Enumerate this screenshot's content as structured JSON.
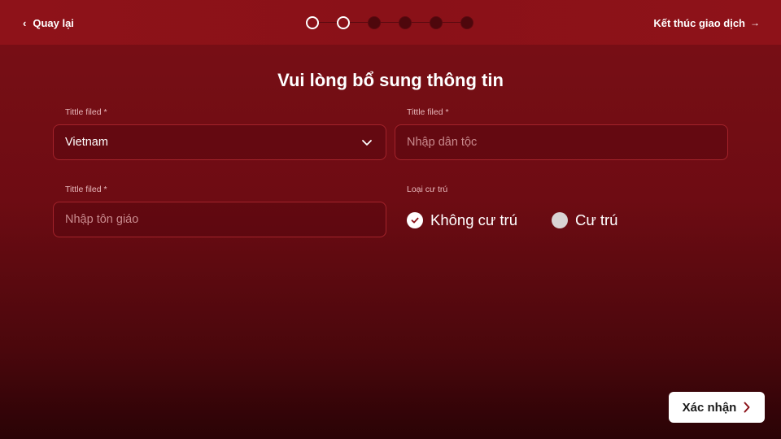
{
  "header": {
    "back_label": "Quay lại",
    "end_label": "Kết thúc giao dịch",
    "steps_total": 6,
    "steps_completed": 2
  },
  "page": {
    "title": "Vui lòng bổ sung thông tin"
  },
  "form": {
    "nationality": {
      "label": "Tittle filed *",
      "value": "Vietnam"
    },
    "ethnicity": {
      "label": "Tittle filed *",
      "placeholder": "Nhập dân tộc"
    },
    "religion": {
      "label": "Tittle filed *",
      "placeholder": "Nhập tôn giáo"
    },
    "residence": {
      "label": "Loại cư trú",
      "options": [
        {
          "label": "Không cư trú",
          "selected": true
        },
        {
          "label": "Cư trú",
          "selected": false
        }
      ]
    }
  },
  "footer": {
    "confirm_label": "Xác nhận"
  },
  "colors": {
    "brand": "#8a1118",
    "field_border": "#a3232b",
    "label": "#e8b9bc",
    "placeholder": "#c98a8e"
  }
}
